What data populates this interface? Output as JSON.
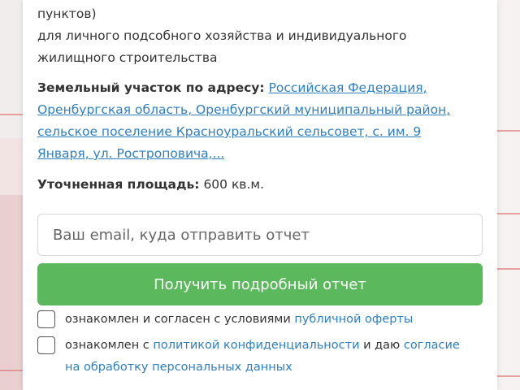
{
  "description": {
    "line1": "пунктов)",
    "line2": "для личного подсобного хозяйства и индивидуального",
    "line3": "жилищного строительства"
  },
  "address": {
    "label": "Земельный участок по адресу:",
    "line1": "Российская Федерация,",
    "line2": "Оренбургская область, Оренбургский муниципальный район,",
    "line3": "сельское поселение Красноуральский сельсовет, с. им. 9",
    "line4": "Января, ул. Ростроповича,..."
  },
  "area": {
    "label": "Уточненная площадь:",
    "value": "600 кв.м."
  },
  "form": {
    "email_placeholder": "Ваш email, куда отправить отчет",
    "submit_label": "Получить подробный отчет"
  },
  "consent1": {
    "text": "ознакомлен и согласен с условиями ",
    "link": "публичной оферты"
  },
  "consent2": {
    "text1": "ознакомлен с ",
    "link1": "политикой конфиденциальности",
    "text2": " и даю ",
    "link2": "согласие",
    "link3": "на обработку персональных данных"
  },
  "colors": {
    "button": "#5cb85c",
    "link": "#2f7fbf"
  }
}
